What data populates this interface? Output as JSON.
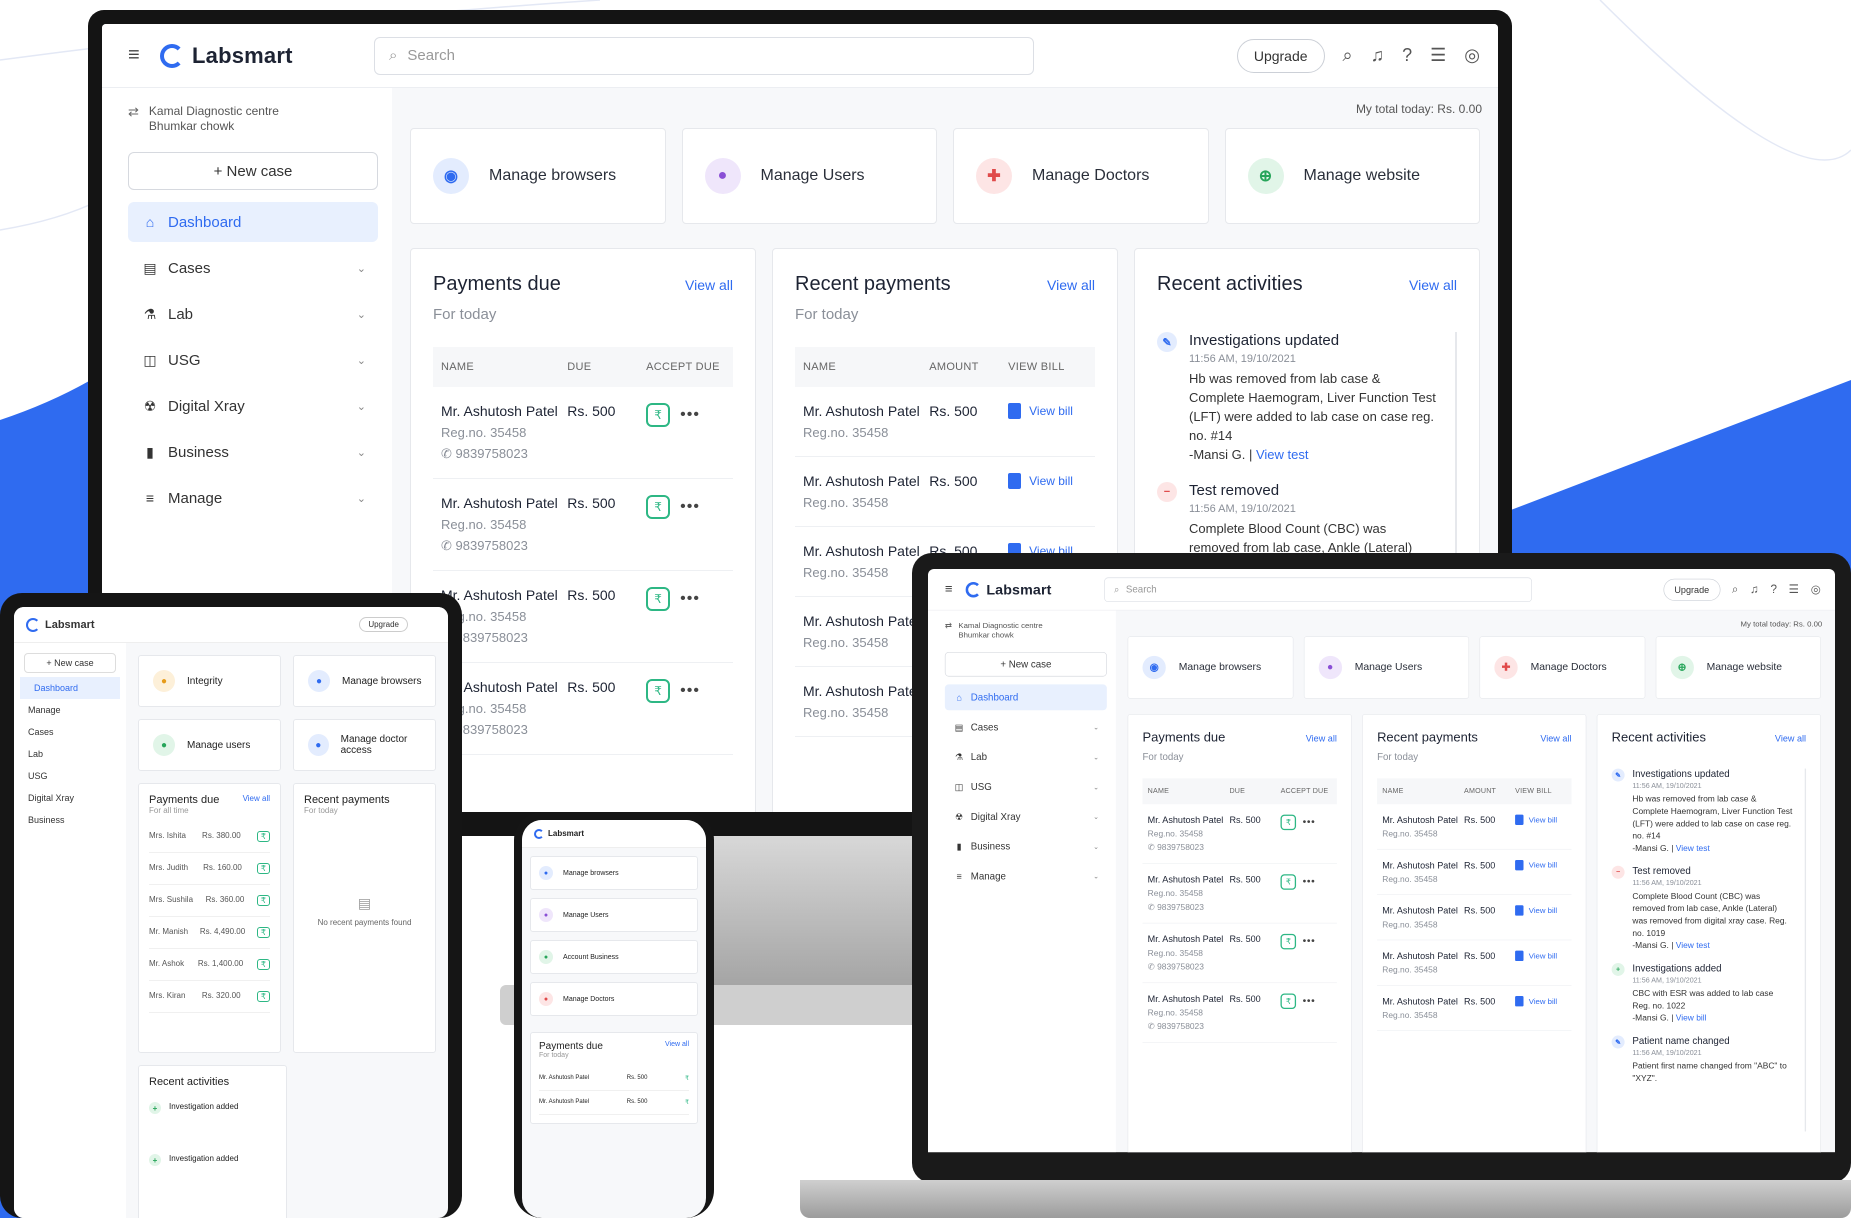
{
  "brand": {
    "name": "Labsmart",
    "accent": "#2f6bf0"
  },
  "topbar": {
    "search_placeholder": "Search",
    "upgrade_label": "Upgrade"
  },
  "sidebar": {
    "centre_name": "Kamal Diagnostic centre Bhumkar chowk",
    "new_case_label": "+ New case",
    "items": [
      {
        "label": "Dashboard",
        "icon": "home-icon",
        "active": true
      },
      {
        "label": "Cases",
        "icon": "cases-icon"
      },
      {
        "label": "Lab",
        "icon": "lab-icon"
      },
      {
        "label": "USG",
        "icon": "usg-icon"
      },
      {
        "label": "Digital Xray",
        "icon": "xray-icon"
      },
      {
        "label": "Business",
        "icon": "chart-icon"
      },
      {
        "label": "Manage",
        "icon": "manage-icon"
      }
    ]
  },
  "main": {
    "total_today": "My total today: Rs. 0.00",
    "quick_actions": [
      {
        "label": "Manage browsers",
        "icon": "browser-icon",
        "color": "#2f6bf0",
        "bg": "#e3ecfe"
      },
      {
        "label": "Manage Users",
        "icon": "users-icon",
        "color": "#8a4fd6",
        "bg": "#efe6fb"
      },
      {
        "label": "Manage Doctors",
        "icon": "doctor-icon",
        "color": "#e04a4a",
        "bg": "#fde5e5"
      },
      {
        "label": "Manage website",
        "icon": "globe-icon",
        "color": "#27a55a",
        "bg": "#e1f5e8"
      }
    ],
    "payments_due": {
      "title": "Payments due",
      "subtitle": "For today",
      "view_all": "View all",
      "columns": [
        "NAME",
        "DUE",
        "ACCEPT DUE"
      ],
      "rows": [
        {
          "name": "Mr. Ashutosh Patel",
          "reg": "Reg.no. 35458",
          "phone": "9839758023",
          "due": "Rs. 500"
        },
        {
          "name": "Mr. Ashutosh Patel",
          "reg": "Reg.no. 35458",
          "phone": "9839758023",
          "due": "Rs. 500"
        },
        {
          "name": "Mr. Ashutosh Patel",
          "reg": "Reg.no. 35458",
          "phone": "9839758023",
          "due": "Rs. 500"
        },
        {
          "name": "Mr. Ashutosh Patel",
          "reg": "Reg.no. 35458",
          "phone": "9839758023",
          "due": "Rs. 500"
        }
      ]
    },
    "recent_payments": {
      "title": "Recent payments",
      "subtitle": "For today",
      "view_all": "View all",
      "columns": [
        "NAME",
        "AMOUNT",
        "VIEW BILL"
      ],
      "view_bill": "View bill",
      "rows": [
        {
          "name": "Mr. Ashutosh Patel",
          "reg": "Reg.no. 35458",
          "amount": "Rs. 500"
        },
        {
          "name": "Mr. Ashutosh Patel",
          "reg": "Reg.no. 35458",
          "amount": "Rs. 500"
        },
        {
          "name": "Mr. Ashutosh Patel",
          "reg": "Reg.no. 35458",
          "amount": "Rs. 500"
        },
        {
          "name": "Mr. Ashutosh Patel",
          "reg": "Reg.no. 35458",
          "amount": "Rs. 500"
        },
        {
          "name": "Mr. Ashutosh Patel",
          "reg": "Reg.no. 35458",
          "amount": "Rs. 500"
        }
      ]
    },
    "recent_activities": {
      "title": "Recent activities",
      "view_all": "View all",
      "items": [
        {
          "title": "Investigations updated",
          "time": "11:56 AM, 19/10/2021",
          "desc": "Hb was removed from lab case & Complete Haemogram, Liver Function Test (LFT) were added to lab case on case reg. no. #14",
          "by": "-Mansi G.",
          "link": "View test",
          "icon": "pencil-icon",
          "color": "#2f6bf0",
          "bg": "#e3ecfe"
        },
        {
          "title": "Test removed",
          "time": "11:56 AM, 19/10/2021",
          "desc": "Complete Blood Count (CBC) was removed from lab case, Ankle (Lateral) was removed from digital xray case. Reg. no. 1019",
          "by": "-Mansi G.",
          "link": "View test",
          "icon": "minus-icon",
          "color": "#e04a4a",
          "bg": "#fde5e5"
        },
        {
          "title": "Investigations added",
          "time": "11:56 AM, 19/10/2021",
          "desc": "CBC with ESR was added to lab case Reg. no. 1022",
          "by": "-Mansi G.",
          "link": "View bill",
          "icon": "plus-icon",
          "color": "#27a55a",
          "bg": "#e1f5e8"
        },
        {
          "title": "Patient name changed",
          "time": "11:56 AM, 19/10/2021",
          "desc": "Patient first name changed from \"ABC\" to \"XYZ\".",
          "by": "",
          "link": "",
          "icon": "pencil-icon",
          "color": "#2f6bf0",
          "bg": "#e3ecfe"
        }
      ]
    }
  },
  "tablet": {
    "quick_actions": [
      "Integrity",
      "Manage browsers",
      "Manage users",
      "Manage doctor access"
    ],
    "payments_title": "Payments due",
    "payments_sub": "For all time",
    "view_all": "View all",
    "recent_title": "Recent payments",
    "recent_sub": "For today",
    "empty_text": "No recent payments found",
    "activities_title": "Recent activities",
    "rows": [
      {
        "name": "Mrs. Ishita",
        "due": "Rs. 380.00"
      },
      {
        "name": "Mrs. Judith",
        "due": "Rs. 160.00"
      },
      {
        "name": "Mrs. Sushila",
        "due": "Rs. 360.00"
      },
      {
        "name": "Mr. Manish",
        "due": "Rs. 4,490.00"
      },
      {
        "name": "Mr. Ashok",
        "due": "Rs. 1,400.00"
      },
      {
        "name": "Mrs. Kiran",
        "due": "Rs. 320.00"
      }
    ],
    "activity_title": "Investigation added"
  },
  "phone": {
    "quick_actions": [
      "Manage browsers",
      "Manage Users",
      "Account Business",
      "Manage Doctors"
    ],
    "payments_title": "Payments due",
    "payments_sub": "For today",
    "view_all": "View all",
    "rows": [
      {
        "name": "Mr. Ashutosh Patel",
        "due": "Rs. 500"
      },
      {
        "name": "Mr. Ashutosh Patel",
        "due": "Rs. 500"
      }
    ]
  }
}
